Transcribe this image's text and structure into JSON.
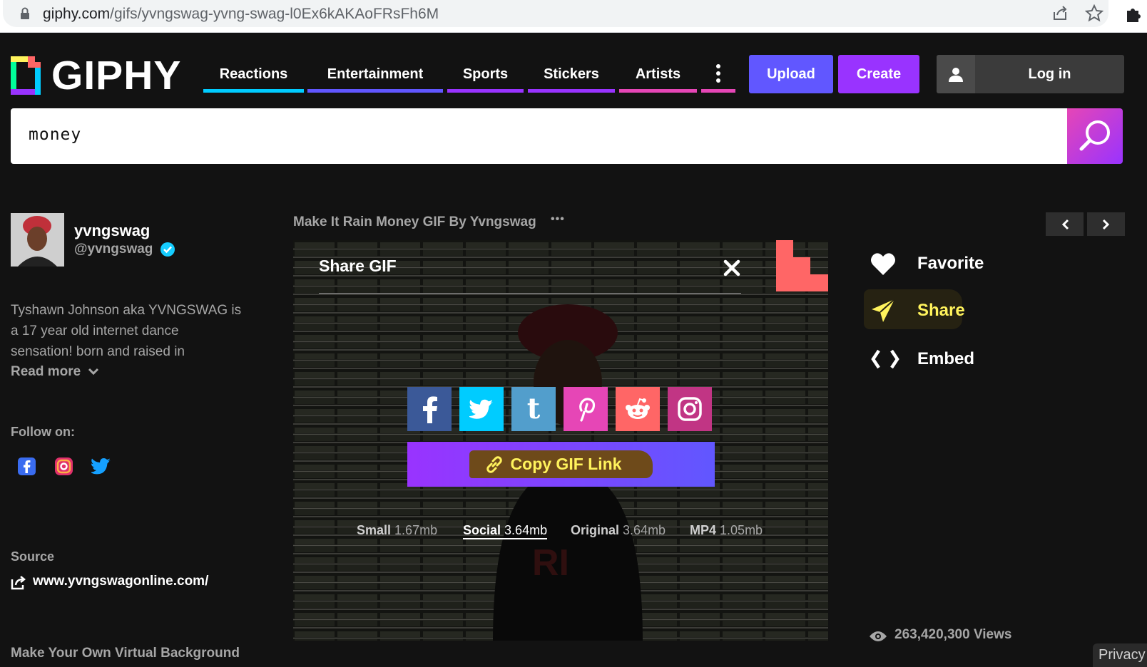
{
  "browser": {
    "url_host": "giphy.com",
    "url_path": "/gifs/yvngswag-yvng-swag-l0Ex6kAKAoFRsFh6M"
  },
  "header": {
    "logo_text": "GIPHY",
    "nav": [
      {
        "label": "Reactions",
        "color": "#00ccff"
      },
      {
        "label": "Entertainment",
        "color": "#6157ff"
      },
      {
        "label": "Sports",
        "color": "#9933ff"
      },
      {
        "label": "Stickers",
        "color": "#9933ff"
      },
      {
        "label": "Artists",
        "color": "#e646b6"
      }
    ],
    "more_color": "#e646b6",
    "upload_label": "Upload",
    "create_label": "Create",
    "login_label": "Log in"
  },
  "search": {
    "value": "money"
  },
  "creator": {
    "display_name": "yvngswag",
    "handle": "@yvngswag",
    "bio_lines": [
      "Tyshawn Johnson aka YVNGSWAG is",
      "a 17 year old internet dance",
      "sensation! born and raised in"
    ],
    "read_more_label": "Read more",
    "follow_label": "Follow on:",
    "source_label": "Source",
    "source_url": "www.yvngswagonline.com/",
    "virtual_bg_label": "Make Your Own Virtual Background"
  },
  "gif": {
    "title": "Make It Rain Money GIF By Yvngswag",
    "more_label": "•••"
  },
  "share_panel": {
    "title": "Share GIF",
    "networks": [
      {
        "name": "facebook",
        "color": "#3b5998"
      },
      {
        "name": "twitter",
        "color": "#00ccff"
      },
      {
        "name": "tumblr",
        "color": "#529ecc"
      },
      {
        "name": "pinterest",
        "color": "#e646b6"
      },
      {
        "name": "reddit",
        "color": "#ff6666"
      },
      {
        "name": "instagram",
        "color": "#c13584"
      }
    ],
    "copy_label": "Copy GIF Link",
    "sizes": [
      {
        "name": "Small",
        "size": "1.67mb",
        "selected": false
      },
      {
        "name": "Social",
        "size": "3.64mb",
        "selected": true
      },
      {
        "name": "Original",
        "size": "3.64mb",
        "selected": false
      },
      {
        "name": "MP4",
        "size": "1.05mb",
        "selected": false
      }
    ]
  },
  "actions": {
    "favorite_label": "Favorite",
    "share_label": "Share",
    "embed_label": "Embed",
    "views": "263,420,300 Views"
  },
  "footer": {
    "privacy_label": "Privacy"
  },
  "colors": {
    "accent_purple": "#9933ff",
    "upload_bg": "#6157ff",
    "share_highlight": "#fff35c"
  }
}
